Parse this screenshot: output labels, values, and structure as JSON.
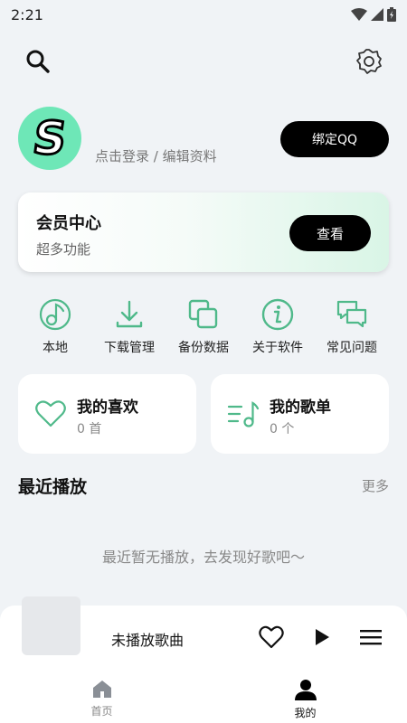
{
  "status": {
    "time": "2:21"
  },
  "icons": {
    "search": "search-icon",
    "settings": "gear-icon"
  },
  "profile": {
    "avatar_letter": "S",
    "login_text": "点击登录 / 编辑资料",
    "bind_button": "绑定QQ"
  },
  "vip": {
    "title": "会员中心",
    "subtitle": "超多功能",
    "button": "查看"
  },
  "quick_actions": [
    {
      "label": "本地",
      "icon": "music-note-icon"
    },
    {
      "label": "下载管理",
      "icon": "download-icon"
    },
    {
      "label": "备份数据",
      "icon": "copy-icon"
    },
    {
      "label": "关于软件",
      "icon": "info-icon"
    },
    {
      "label": "常见问题",
      "icon": "chat-bubbles-icon"
    }
  ],
  "cards": [
    {
      "title": "我的喜欢",
      "count": "0 首",
      "icon": "heart-icon"
    },
    {
      "title": "我的歌单",
      "count": "0 个",
      "icon": "playlist-icon"
    }
  ],
  "recent": {
    "title": "最近播放",
    "more": "更多",
    "empty": "最近暂无播放，去发现好歌吧～"
  },
  "player": {
    "title": "未播放歌曲"
  },
  "nav": [
    {
      "label": "首页",
      "active": false
    },
    {
      "label": "我的",
      "active": true
    }
  ],
  "colors": {
    "accent": "#4fb98a",
    "avatar_bg": "#6ee7b7",
    "page_bg": "#f0f3f6"
  }
}
